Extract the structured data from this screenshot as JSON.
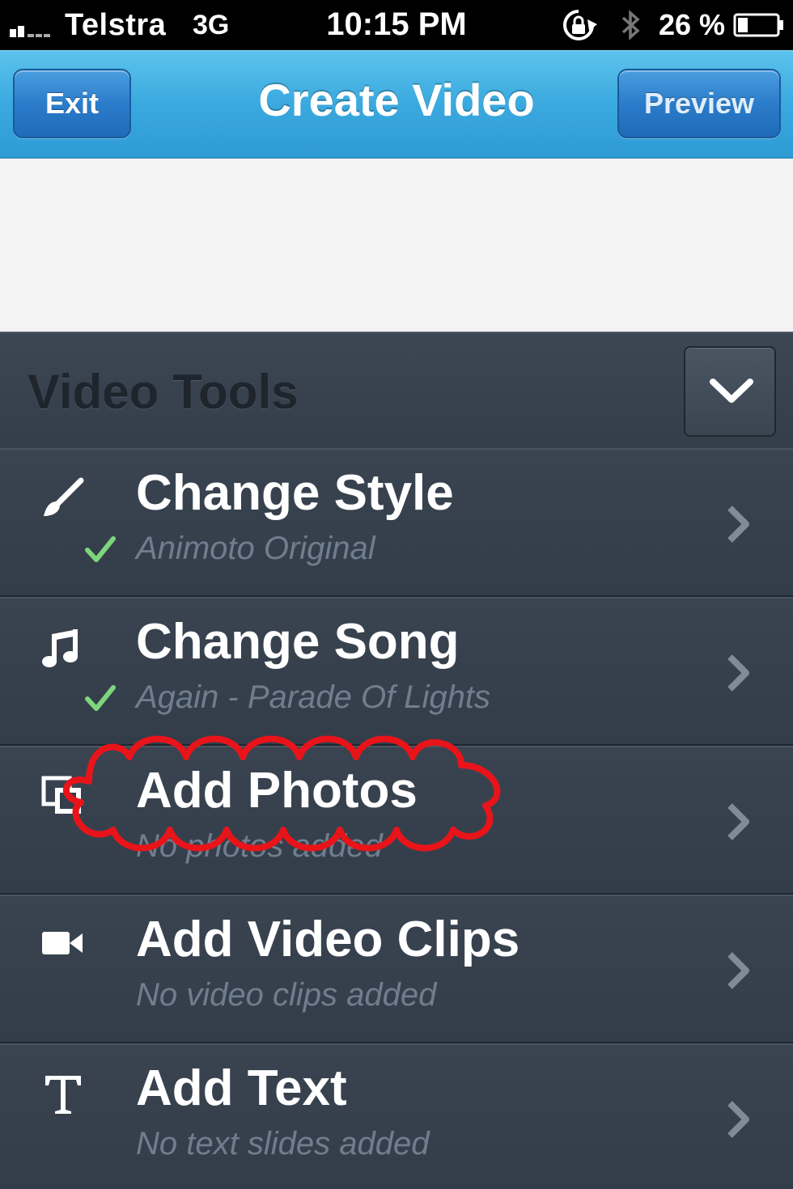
{
  "status_bar": {
    "carrier": "Telstra",
    "network": "3G",
    "time": "10:15 PM",
    "battery_percent": "26 %",
    "icons": [
      "signal-icon",
      "rotation-lock-icon",
      "bluetooth-icon",
      "battery-icon"
    ]
  },
  "nav": {
    "title": "Create Video",
    "exit_label": "Exit",
    "preview_label": "Preview"
  },
  "tools": {
    "header": "Video Tools",
    "items": [
      {
        "icon": "paintbrush-icon",
        "title": "Change Style",
        "subtitle": "Animoto Original",
        "checked": true
      },
      {
        "icon": "music-note-icon",
        "title": "Change Song",
        "subtitle": "Again - Parade Of Lights",
        "checked": true
      },
      {
        "icon": "photos-icon",
        "title": "Add Photos",
        "subtitle": "No photos added",
        "checked": false
      },
      {
        "icon": "video-camera-icon",
        "title": "Add Video Clips",
        "subtitle": "No video clips added",
        "checked": false
      },
      {
        "icon": "text-icon",
        "title": "Add Text",
        "subtitle": "No text slides added",
        "checked": false
      }
    ]
  },
  "colors": {
    "nav_bar": "#3aa9df",
    "panel": "#343e4a",
    "check": "#7ed67a",
    "annotation": "#e8141a"
  }
}
